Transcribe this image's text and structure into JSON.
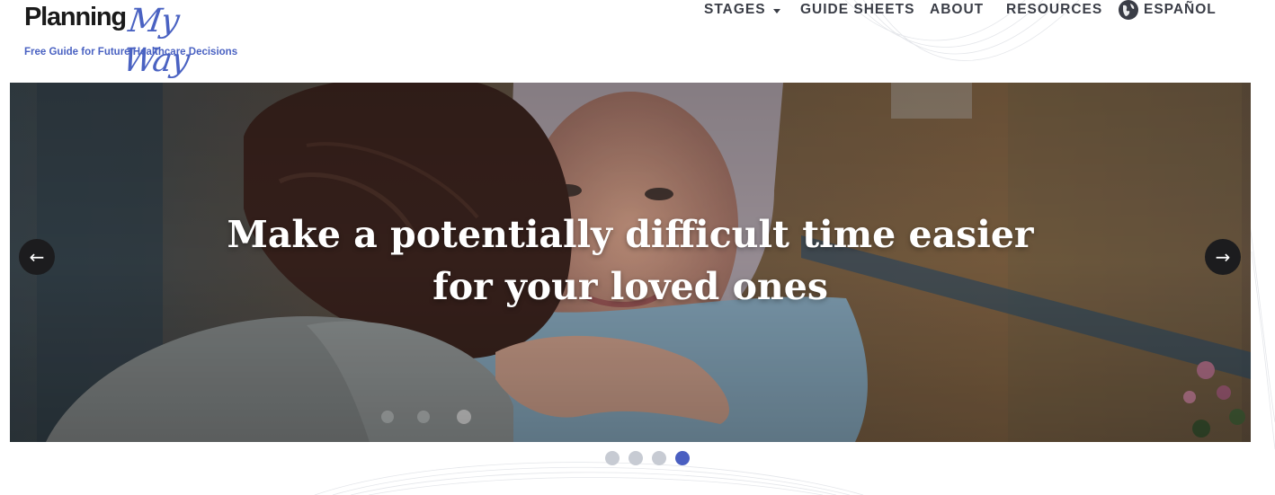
{
  "logo": {
    "word": "Planning",
    "script": "My Way",
    "tagline": "Free Guide for Future Healthcare Decisions"
  },
  "nav": {
    "items": [
      {
        "label": "STAGES",
        "icon": "caret-down-icon"
      },
      {
        "label": "GUIDE SHEETS"
      },
      {
        "label": "ABOUT"
      },
      {
        "label": "RESOURCES"
      },
      {
        "label": "ESPAÑOL",
        "icon": "globe-icon"
      }
    ]
  },
  "hero": {
    "headline": "Make a potentially difficult time easier for your loved ones",
    "prev_icon": "←",
    "next_icon": "→"
  },
  "carousel": {
    "slide_count": 4,
    "active_slide": 4
  },
  "colors": {
    "brand_blue": "#4a62c2",
    "nav_text": "#3a3d46",
    "dot_inactive": "#c7cbd3",
    "dot_active": "#4a5fc1"
  }
}
